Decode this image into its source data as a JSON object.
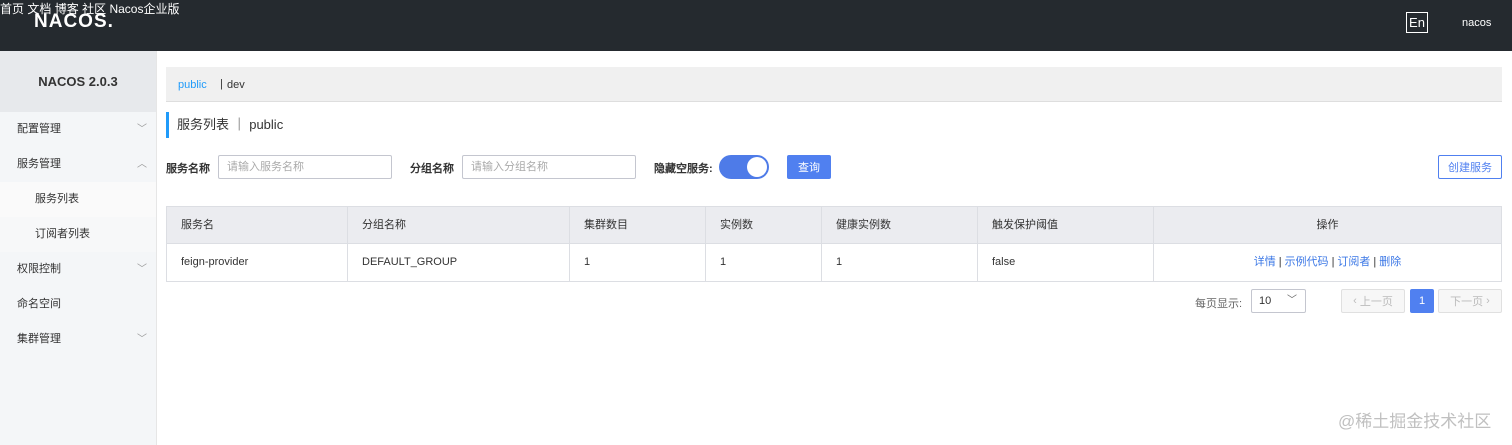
{
  "header": {
    "logo": "NACOS.",
    "nav": [
      "首页",
      "文档",
      "博客",
      "社区",
      "Nacos企业版"
    ],
    "lang": "En",
    "user": "nacos"
  },
  "sidebar": {
    "title": "NACOS 2.0.3",
    "items": [
      {
        "label": "配置管理",
        "chevron": "chevron-down"
      },
      {
        "label": "服务管理",
        "chevron": "chevron-up"
      },
      {
        "label": "服务列表"
      },
      {
        "label": "订阅者列表"
      },
      {
        "label": "权限控制",
        "chevron": "chevron-down"
      },
      {
        "label": "命名空间"
      },
      {
        "label": "集群管理",
        "chevron": "chevron-down"
      }
    ]
  },
  "namespace": {
    "current": "public",
    "separator": "|",
    "other": "dev"
  },
  "page": {
    "title": "服务列表 ｜ public"
  },
  "filters": {
    "service_name_label": "服务名称",
    "service_name_placeholder": "请输入服务名称",
    "group_name_label": "分组名称",
    "group_name_placeholder": "请输入分组名称",
    "hide_empty_label": "隐藏空服务:",
    "hide_empty_on": true,
    "query_button": "查询",
    "create_button": "创建服务"
  },
  "table": {
    "columns": [
      "服务名",
      "分组名称",
      "集群数目",
      "实例数",
      "健康实例数",
      "触发保护阈值",
      "操作"
    ],
    "rows": [
      {
        "service": "feign-provider",
        "group": "DEFAULT_GROUP",
        "clusters": "1",
        "instances": "1",
        "healthy": "1",
        "threshold": "false"
      }
    ],
    "actions": [
      "详情",
      "示例代码",
      "订阅者",
      "删除"
    ]
  },
  "pagination": {
    "page_size_label": "每页显示:",
    "page_size": "10",
    "prev": "上一页",
    "current": "1",
    "next": "下一页"
  },
  "watermark": "@稀土掘金技术社区",
  "colors": {
    "topbar": "#252a2f",
    "accent": "#5080f0",
    "link": "#209bfa"
  }
}
